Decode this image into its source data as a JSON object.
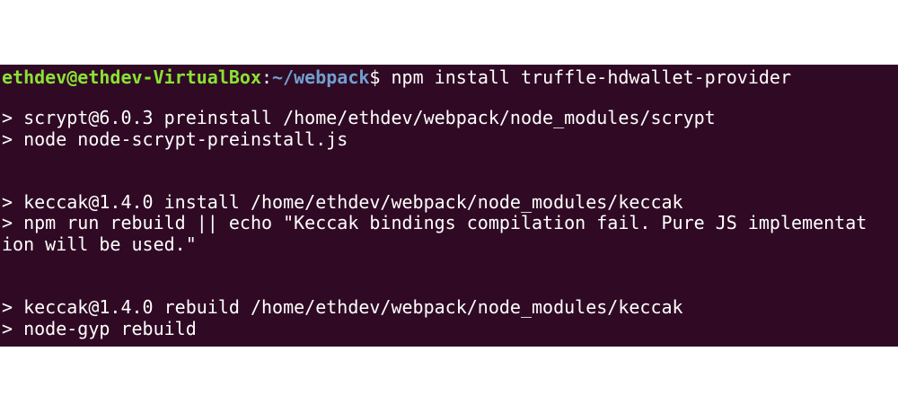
{
  "terminal": {
    "prompt": {
      "user_host": "ethdev@ethdev-VirtualBox",
      "separator": ":",
      "path": "~/webpack",
      "symbol": "$",
      "command": " npm install truffle-hdwallet-provider"
    },
    "output": [
      "> scrypt@6.0.3 preinstall /home/ethdev/webpack/node_modules/scrypt",
      "> node node-scrypt-preinstall.js",
      "> keccak@1.4.0 install /home/ethdev/webpack/node_modules/keccak",
      "> npm run rebuild || echo \"Keccak bindings compilation fail. Pure JS implementat",
      "ion will be used.\"",
      "> keccak@1.4.0 rebuild /home/ethdev/webpack/node_modules/keccak",
      "> node-gyp rebuild"
    ]
  },
  "colors": {
    "background": "#300a24",
    "user_host": "#8ae234",
    "path": "#729fcf",
    "text": "#ffffff"
  }
}
